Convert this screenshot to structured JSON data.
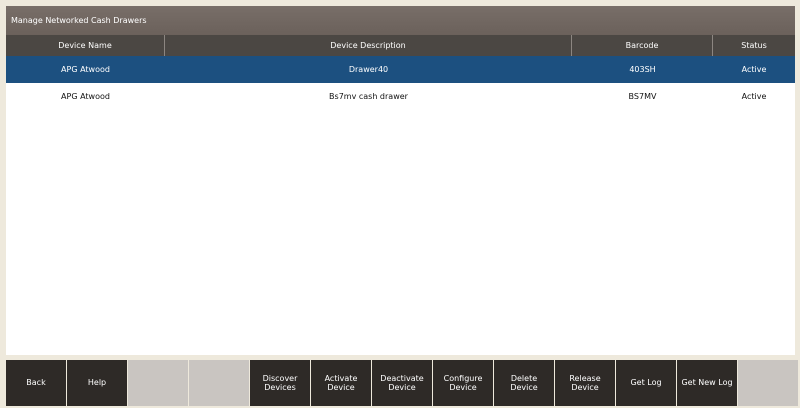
{
  "window": {
    "title": "Manage Networked Cash Drawers"
  },
  "grid": {
    "columns": {
      "name": "Device Name",
      "description": "Device Description",
      "barcode": "Barcode",
      "status": "Status"
    },
    "rows": [
      {
        "name": "APG Atwood",
        "description": "Drawer40",
        "barcode": "403SH",
        "status": "Active",
        "selected": true
      },
      {
        "name": "APG Atwood",
        "description": "Bs7mv cash drawer",
        "barcode": "BS7MV",
        "status": "Active",
        "selected": false
      }
    ]
  },
  "toolbar": {
    "back": "Back",
    "help": "Help",
    "discover": "Discover Devices",
    "activate": "Activate Device",
    "deactivate": "Deactivate Device",
    "configure": "Configure Device",
    "delete": "Delete Device",
    "release": "Release Device",
    "get_log": "Get Log",
    "get_new_log": "Get New Log"
  },
  "colors": {
    "selected_row": "#1c5080",
    "header": "#4b4743",
    "button": "#2e2a27",
    "disabled_button": "#c9c5c1"
  }
}
